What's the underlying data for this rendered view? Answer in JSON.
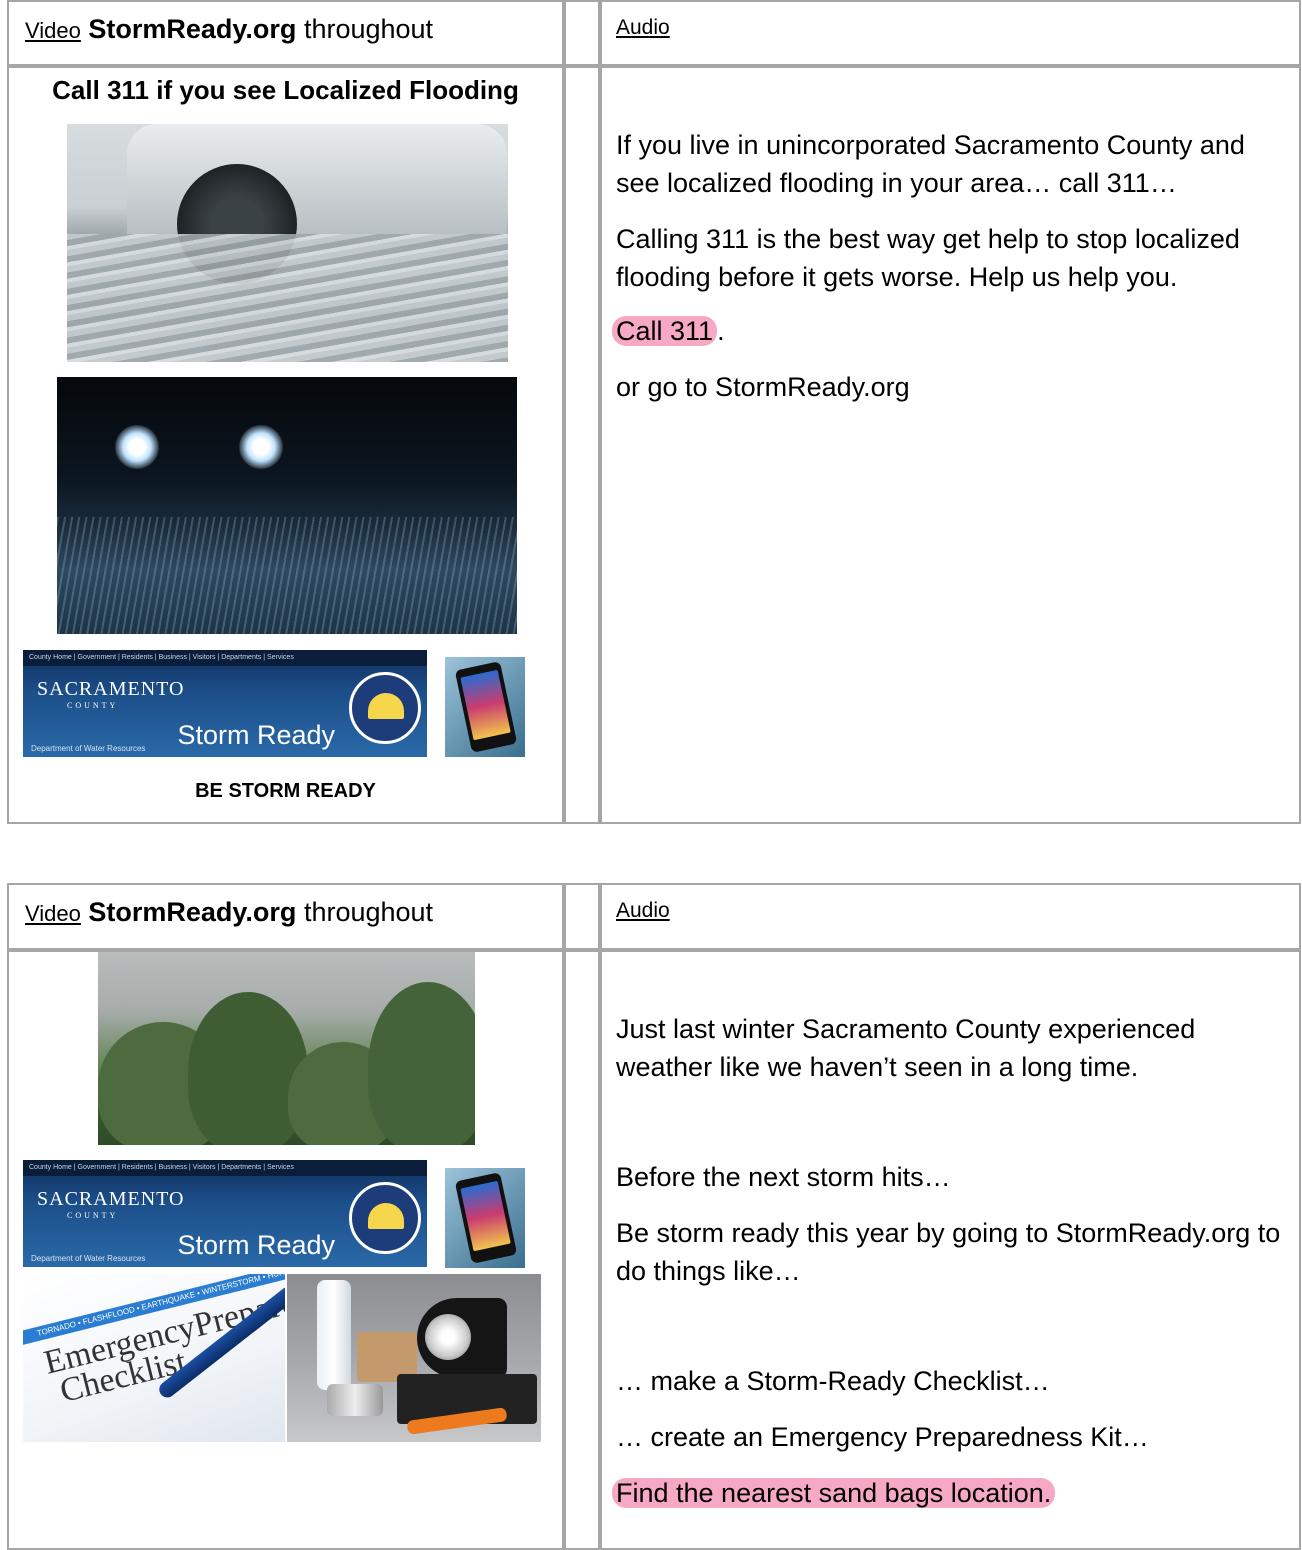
{
  "table1": {
    "header": {
      "video_prefix": "Video",
      "video_bold": "StormReady.org",
      "video_suffix": " throughout",
      "audio": "Audio"
    },
    "video": {
      "caption_top": "Call 311 if you see Localized Flooding",
      "caption_bottom": "BE STORM READY"
    },
    "audio_lines": [
      "If you live in unincorporated Sacramento County and see localized flooding in your area… call 311…",
      "Calling 311 is the best way get help to stop localized flooding before it gets worse. Help us help you.",
      "or go to StormReady.org"
    ],
    "audio_highlight": "Call 311",
    "audio_highlight_tail": "."
  },
  "table2": {
    "header": {
      "video_prefix": "Video",
      "video_bold": "StormReady.org",
      "video_suffix": " throughout",
      "audio": "Audio"
    },
    "audio_lines": [
      "Just last winter Sacramento County experienced weather like we haven’t seen in a long time.",
      "Before the next storm hits…",
      "Be storm ready this year by going to StormReady.org to do things like…",
      "… make a Storm-Ready Checklist…",
      "… create an Emergency Preparedness Kit…"
    ],
    "audio_highlight": "Find the nearest sand bags location."
  },
  "banner": {
    "nav": "County Home | Government | Residents | Business | Visitors | Departments | Services",
    "brand": "SACRAMENTO",
    "brand_sub": "COUNTY",
    "title": "Storm Ready",
    "dept": "Department of Water Resources"
  },
  "checklist": {
    "band": "TORNADO • FLASHFLOOD • EARTHQUAKE • WINTERSTORM • HURRICANE",
    "word1": "EmergencyPrepared",
    "word2": "Checklist"
  },
  "colors": {
    "border": "#a6a6a6",
    "highlight": "#f7a8c4"
  }
}
